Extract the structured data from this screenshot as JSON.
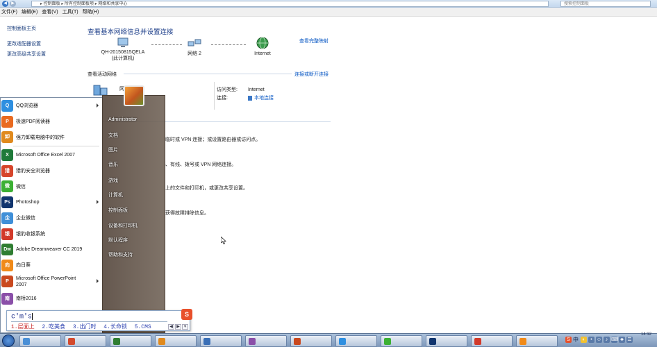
{
  "window": {
    "address": "▸ 控制面板 ▸ 所有控制面板项 ▸ 网络和共享中心",
    "search_placeholder": "搜索控制面板"
  },
  "menubar": [
    "文件(F)",
    "编辑(E)",
    "查看(V)",
    "工具(T)",
    "帮助(H)"
  ],
  "sidebar": {
    "home": "控制面板主页",
    "links": [
      "更改适配器设置",
      "更改高级共享设置"
    ]
  },
  "main": {
    "title": "查看基本网络信息并设置连接",
    "view_full_map": "查看完整映射",
    "pc_name": "QH-20150815QELA",
    "pc_sub": "(此计算机)",
    "network_name": "网络  2",
    "internet": "Internet",
    "active_networks": "查看活动网络",
    "connect_disconnect": "连接或断开连接",
    "net_partial": "网",
    "access_type_label": "访问类型:",
    "access_type_value": "Internet",
    "connections_label": "连接:",
    "connections_value": "本地连接",
    "tasks": [
      "临时或 VPN 连接；或设置路由器或访问点。",
      "、有线、拨号或 VPN 网络连接。",
      "上的文件和打印机，或更改共享设置。",
      "获得故障排除信息。"
    ]
  },
  "start_menu": {
    "programs": [
      {
        "label": "QQ浏览器",
        "icon": "qq-browser-icon",
        "color": "#2f8fe0",
        "glyph": "Q",
        "arrow": true
      },
      {
        "label": "极速PDF阅读器",
        "icon": "pdf-reader-icon",
        "color": "#e96a20",
        "glyph": "P",
        "arrow": false
      },
      {
        "label": "强力卸载电脑中的软件",
        "icon": "uninstall-icon",
        "color": "#e08a1e",
        "glyph": "卸",
        "arrow": false
      },
      {
        "label": "Microsoft Office Excel 2007",
        "icon": "excel-icon",
        "color": "#1f7a3a",
        "glyph": "X",
        "arrow": false
      },
      {
        "label": "猎豹安全浏览器",
        "icon": "liebao-browser-icon",
        "color": "#d6452b",
        "glyph": "猎",
        "arrow": false
      },
      {
        "label": "微信",
        "icon": "wechat-icon",
        "color": "#3cb034",
        "glyph": "微",
        "arrow": false
      },
      {
        "label": "Photoshop",
        "icon": "photoshop-icon",
        "color": "#11356e",
        "glyph": "Ps",
        "arrow": true
      },
      {
        "label": "企业微信",
        "icon": "wework-icon",
        "color": "#3f8fd8",
        "glyph": "企",
        "arrow": false
      },
      {
        "label": "银豹收银系统",
        "icon": "cashier-icon",
        "color": "#d23a2a",
        "glyph": "银",
        "arrow": false
      },
      {
        "label": "Adobe Dreamweaver CC 2019",
        "icon": "dreamweaver-icon",
        "color": "#2f7d32",
        "glyph": "Dw",
        "arrow": false
      },
      {
        "label": "向日葵",
        "icon": "sunflower-icon",
        "color": "#f08a19",
        "glyph": "向",
        "arrow": false
      },
      {
        "label": "Microsoft Office PowerPoint\n2007",
        "icon": "powerpoint-icon",
        "color": "#c9491f",
        "glyph": "P",
        "arrow": true
      },
      {
        "label": "南桥2016",
        "icon": "nanqiao-icon",
        "color": "#8a4fa8",
        "glyph": "南",
        "arrow": false
      }
    ],
    "right_items": [
      "Administrator",
      "文档",
      "图片",
      "音乐",
      "游戏",
      "计算机",
      "控制面板",
      "设备和打印机",
      "默认程序",
      "帮助和支持"
    ]
  },
  "ime": {
    "composition": "c'm's",
    "candidates": [
      "1.层面上",
      "2.吃美食",
      "3.出门时",
      "4.长命锁",
      "5.CMS"
    ]
  },
  "taskbar": {
    "buttons": [
      {
        "color": "#4a8fd6"
      },
      {
        "color": "#d34a2e"
      },
      {
        "color": "#2f7d32"
      },
      {
        "color": "#e08a1e"
      },
      {
        "color": "#3a6fb6"
      },
      {
        "color": "#8a4fa8"
      },
      {
        "color": "#c9491f"
      },
      {
        "color": "#2f8fe0"
      },
      {
        "color": "#3cb034"
      },
      {
        "color": "#11356e"
      },
      {
        "color": "#d23a2a"
      },
      {
        "color": "#f08a19"
      }
    ],
    "tray_lang": "中",
    "clock": "14:12"
  }
}
